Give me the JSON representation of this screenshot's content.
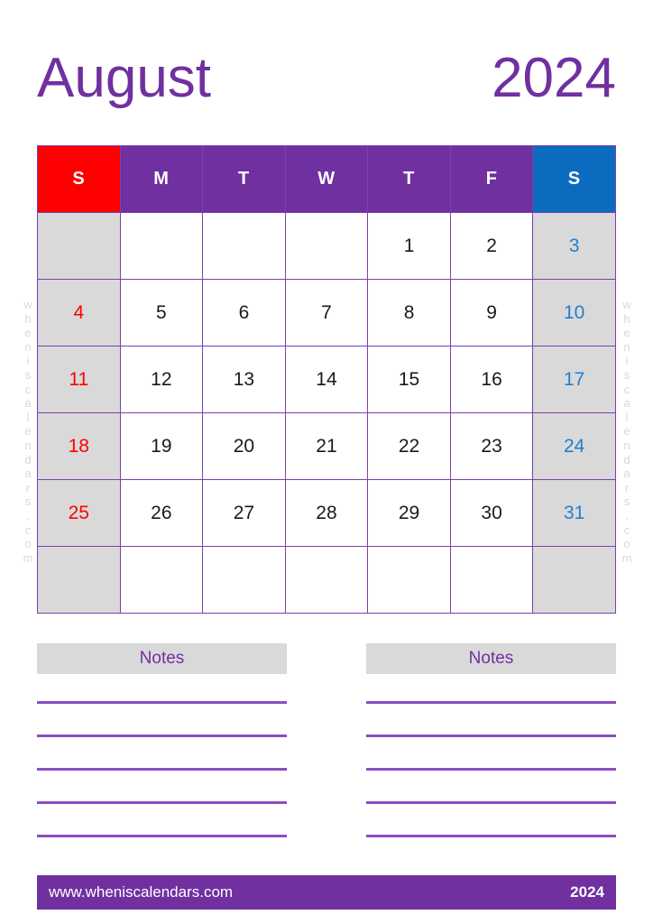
{
  "title": {
    "month": "August",
    "year": "2024"
  },
  "calendar": {
    "weekday_headers": [
      {
        "label": "S",
        "kind": "sunday"
      },
      {
        "label": "M",
        "kind": "weekday"
      },
      {
        "label": "T",
        "kind": "weekday"
      },
      {
        "label": "W",
        "kind": "weekday"
      },
      {
        "label": "T",
        "kind": "weekday"
      },
      {
        "label": "F",
        "kind": "weekday"
      },
      {
        "label": "S",
        "kind": "saturday"
      }
    ],
    "weeks": [
      [
        "",
        "",
        "",
        "",
        "1",
        "2",
        "3"
      ],
      [
        "4",
        "5",
        "6",
        "7",
        "8",
        "9",
        "10"
      ],
      [
        "11",
        "12",
        "13",
        "14",
        "15",
        "16",
        "17"
      ],
      [
        "18",
        "19",
        "20",
        "21",
        "22",
        "23",
        "24"
      ],
      [
        "25",
        "26",
        "27",
        "28",
        "29",
        "30",
        "31"
      ],
      [
        "",
        "",
        "",
        "",
        "",
        "",
        ""
      ]
    ]
  },
  "notes": {
    "left_title": "Notes",
    "right_title": "Notes",
    "line_count": 5
  },
  "footer": {
    "url": "www.wheniscalendars.com",
    "year": "2024"
  },
  "watermark": {
    "text": "wheniscalendars.com"
  },
  "colors": {
    "purple": "#7030a0",
    "sunday_red": "#fe0000",
    "saturday_blue": "#0b6cbf",
    "saturday_text_blue": "#1f7fd0",
    "weekend_cell_gray": "#d9d9d9",
    "grid_line": "#7b3fb0",
    "notes_line": "#8b4ec0"
  }
}
